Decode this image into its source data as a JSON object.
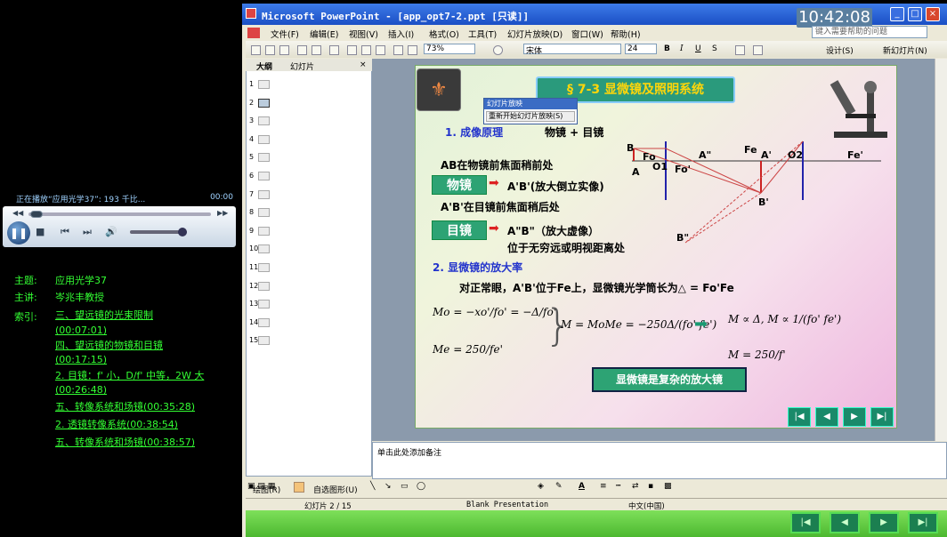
{
  "player": {
    "now_playing": "正在播放“应用光学37”: 193 千比...",
    "time": "00:00",
    "controls": [
      "⏮",
      "⏹",
      "◀◀",
      "▶▶"
    ]
  },
  "meta": {
    "subject_label": "主题:",
    "subject": "应用光学37",
    "lecturer_label": "主讲:",
    "lecturer": "岑兆丰教授",
    "index_label": "索引:",
    "index": [
      "三、望远镜的光束限制",
      "(00:07:01)",
      "四、望远镜的物镜和目镜",
      "(00:17:15)",
      "2. 目镜：f' 小，D/f' 中等，2W 大",
      "(00:26:48)",
      "五、转像系统和场镜(00:35:28)",
      "2. 透镜转像系统(00:38:54)",
      "五、转像系统和场镜(00:38:57)"
    ]
  },
  "window": {
    "title": "Microsoft PowerPoint - [app_opt7-2.ppt [只读]]",
    "clock": "10:42:08",
    "help_placeholder": "键入需要帮助的问题"
  },
  "menu": [
    "文件(F)",
    "编辑(E)",
    "视图(V)",
    "插入(I)",
    "格式(O)",
    "工具(T)",
    "幻灯片放映(D)",
    "窗口(W)",
    "帮助(H)"
  ],
  "toolbar": {
    "zoom": "73%",
    "font": "宋体",
    "size": "24",
    "design": "设计(S)",
    "new_slide": "新幻灯片(N)"
  },
  "panel": {
    "tab_outline": "大纲",
    "tab_slides": "幻灯片",
    "slide_numbers": [
      "1",
      "2",
      "3",
      "4",
      "5",
      "6",
      "7",
      "8",
      "9",
      "10",
      "11",
      "12",
      "13",
      "14",
      "15"
    ]
  },
  "popup": {
    "title": "幻灯片放映",
    "button": "重新开始幻灯片放映(S)"
  },
  "slide": {
    "title": "§ 7-3  显微镜及照明系统",
    "h1": "1. 成像原理",
    "h1b": "物镜 + 目镜",
    "l1": "AB在物镜前焦面稍前处",
    "obj": "物镜",
    "r1": "A'B'(放大倒立实像)",
    "l2": "A'B'在目镜前焦面稍后处",
    "eye": "目镜",
    "r2": "A\"B\"（放大虚像）",
    "r3": "位于无穷远或明视距离处",
    "h2": "2. 显微镜的放大率",
    "l3": "对正常眼，A'B'位于Fe上，显微镜光学筒长为△ = Fo'Fe",
    "conclusion": "显微镜是复杂的放大镜",
    "eq1": "Mo = −xo'/fo' = −Δ/fo'",
    "eq2": "Me = 250/fe'",
    "eq3": "M = MoMe = −250Δ/(fo' fe')",
    "eq4": "M ∝ Δ, M ∝ 1/(fo' fe')",
    "eq5": "M = 250/f'",
    "diagram_labels": [
      "B",
      "Fo",
      "A",
      "O1",
      "Fo'",
      "A\"",
      "Fe",
      "A'",
      "O2",
      "Fe'",
      "B'",
      "B\""
    ]
  },
  "notes": "单击此处添加备注",
  "drawbar": {
    "draw": "绘图(R)",
    "autoshapes": "自选图形(U)"
  },
  "status": {
    "slide": "幻灯片 2 / 15",
    "design": "Blank Presentation",
    "lang": "中文(中国)"
  }
}
